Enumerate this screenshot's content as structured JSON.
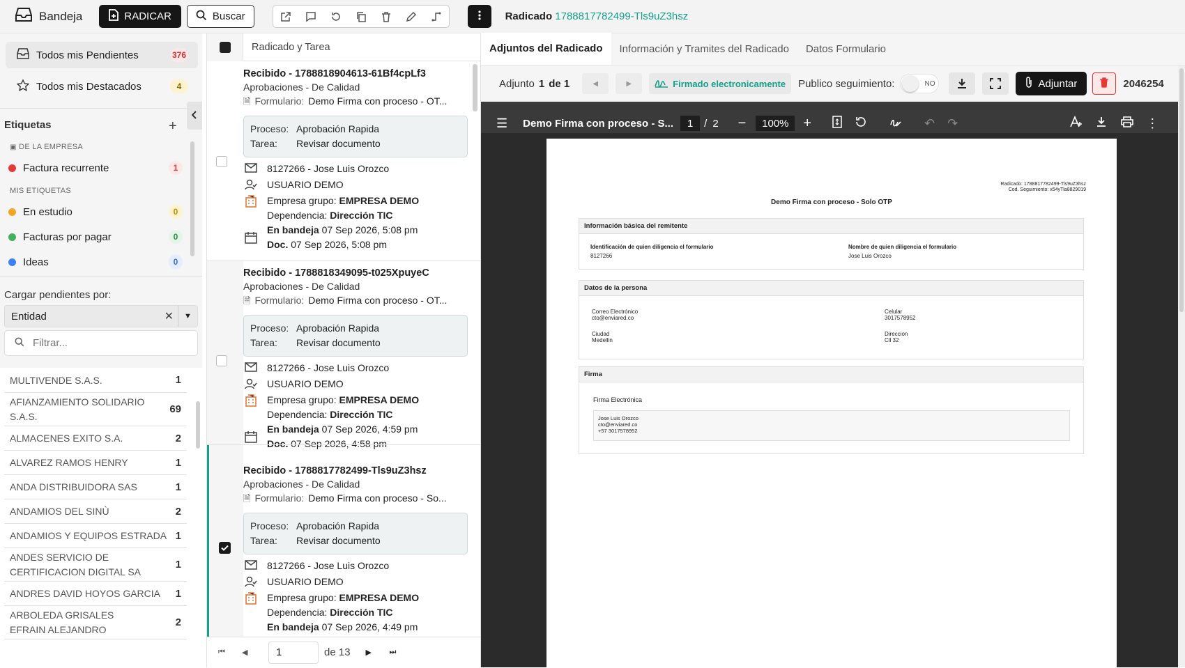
{
  "topbar": {
    "brand": "Bandeja",
    "radicar_label": "RADICAR",
    "buscar_label": "Buscar",
    "radicado_label": "Radicado",
    "radicado_id": "1788817782499-Tls9uZ3hsz"
  },
  "sidebar": {
    "nav": [
      {
        "label": "Todos mis Pendientes",
        "count": "376"
      },
      {
        "label": "Todos mis Destacados",
        "count": "4"
      }
    ],
    "etiquetas_title": "Etiquetas",
    "group_empresa": "DE LA EMPRESA",
    "group_mis": "MIS ETIQUETAS",
    "labels": [
      {
        "label": "Factura recurrente",
        "count": "1",
        "color": "#e53935"
      },
      {
        "label": "En estudio",
        "count": "0",
        "color": "#f5a623"
      },
      {
        "label": "Facturas por pagar",
        "count": "0",
        "color": "#43b05c"
      },
      {
        "label": "Ideas",
        "count": "0",
        "color": "#3b82f6"
      }
    ],
    "cargar_label": "Cargar pendientes por:",
    "select_value": "Entidad",
    "filter_placeholder": "Filtrar...",
    "entities": [
      {
        "name": "MULTIVENDE S.A.S.",
        "count": "1"
      },
      {
        "name": "AFIANZAMIENTO SOLIDARIO S.A.S.",
        "count": "69"
      },
      {
        "name": "ALMACENES EXITO S.A.",
        "count": "2"
      },
      {
        "name": "ALVAREZ RAMOS HENRY",
        "count": "1"
      },
      {
        "name": "ANDA DISTRIBUIDORA SAS",
        "count": "1"
      },
      {
        "name": "ANDAMIOS DEL SINÙ",
        "count": "2"
      },
      {
        "name": "ANDAMIOS Y EQUIPOS ESTRADA",
        "count": "1"
      },
      {
        "name": "ANDES SERVICIO DE CERTIFICACION DIGITAL SA",
        "count": "1"
      },
      {
        "name": "ANDRES DAVID HOYOS GARCIA",
        "count": "1"
      },
      {
        "name": "ARBOLEDA GRISALES EFRAIN ALEJANDRO",
        "count": "2"
      }
    ]
  },
  "list": {
    "header": "Radicado y Tarea",
    "cards": [
      {
        "title": "Recibido - 1788818904613-61Bf4cpLf3",
        "sub": "Aprobaciones - De Calidad",
        "form_label": "Formulario:",
        "form": "Demo Firma con proceso - OT...",
        "proceso_label": "Proceso:",
        "proceso": "Aprobación Rapida",
        "tarea_label": "Tarea:",
        "tarea": "Revisar documento",
        "sender": "8127266 - Jose Luis Orozco",
        "user": "USUARIO DEMO",
        "empresa_label": "Empresa grupo:",
        "empresa": "EMPRESA DEMO",
        "dep_label": "Dependencia:",
        "dep": "Dirección TIC",
        "bandeja_label": "En bandeja",
        "bandeja": "07 Sep 2026, 5:08 pm",
        "doc_label": "Doc.",
        "doc": "07 Sep 2026, 5:08 pm"
      },
      {
        "title": "Recibido - 1788818349095-t025XpuyeC",
        "sub": "Aprobaciones - De Calidad",
        "form_label": "Formulario:",
        "form": "Demo Firma con proceso - OT...",
        "proceso_label": "Proceso:",
        "proceso": "Aprobación Rapida",
        "tarea_label": "Tarea:",
        "tarea": "Revisar documento",
        "sender": "8127266 - Jose Luis Orozco",
        "user": "USUARIO DEMO",
        "empresa_label": "Empresa grupo:",
        "empresa": "EMPRESA DEMO",
        "dep_label": "Dependencia:",
        "dep": "Dirección TIC",
        "bandeja_label": "En bandeja",
        "bandeja": "07 Sep 2026, 4:59 pm",
        "doc_label": "Doc.",
        "doc": "07 Sep 2026, 4:58 pm"
      },
      {
        "title": "Recibido - 1788817782499-Tls9uZ3hsz",
        "sub": "Aprobaciones - De Calidad",
        "form_label": "Formulario:",
        "form": "Demo Firma con proceso - So...",
        "proceso_label": "Proceso:",
        "proceso": "Aprobación Rapida",
        "tarea_label": "Tarea:",
        "tarea": "Revisar documento",
        "sender": "8127266 - Jose Luis Orozco",
        "user": "USUARIO DEMO",
        "empresa_label": "Empresa grupo:",
        "empresa": "EMPRESA DEMO",
        "dep_label": "Dependencia:",
        "dep": "Dirección TIC",
        "bandeja_label": "En bandeja",
        "bandeja": "07 Sep 2026, 4:49 pm"
      }
    ],
    "pager": {
      "page": "1",
      "of": "de 13"
    }
  },
  "viewer": {
    "tabs": [
      "Adjuntos del Radicado",
      "Información y Tramites del Radicado",
      "Datos Formulario"
    ],
    "adjunto_label": "Adjunto",
    "adjunto_current": "1",
    "adjunto_de": "de 1",
    "firmado": "Firmado electronicamente",
    "publico": "Publico seguimiento:",
    "toggle": "NO",
    "adjuntar": "Adjuntar",
    "code": "2046254",
    "pdf": {
      "title": "Demo Firma con proceso - S...",
      "page": "1",
      "sep": "/",
      "pages": "2",
      "zoom": "100%"
    },
    "doc": {
      "radicado_line": "Radicado: 1788817782499-Tls9uZ3hsz",
      "cod_line": "Cod. Seguimiento: x54yTla8829019",
      "title": "Demo Firma con proceso - Solo OTP",
      "sec1": "Información básica del remitente",
      "id_label": "Identificación de quien diligencia el formulario",
      "id_value": "8127266",
      "name_label": "Nombre de quien diligencia el formulario",
      "name_value": "Jose Luis Orozco",
      "sec2": "Datos de la persona",
      "correo_label": "Correo Electrónico",
      "correo_value": "cto@enviared.co",
      "celular_label": "Celular",
      "celular_value": "3017578952",
      "ciudad_label": "Ciudad",
      "ciudad_value": "Medellin",
      "direccion_label": "Direccion",
      "direccion_value": "Cll 32",
      "sec3": "Firma",
      "firma_label": "Firma Electrónica",
      "firma_name": "Jose Luis Orozco",
      "firma_email": "cto@enviared.co",
      "firma_phone": "+57 3017578952"
    }
  }
}
